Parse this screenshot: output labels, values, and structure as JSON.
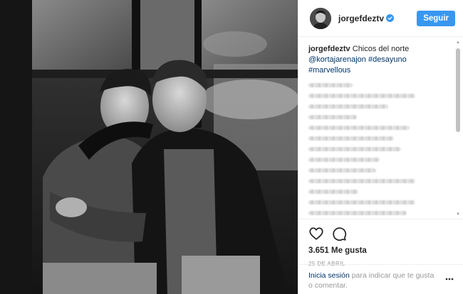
{
  "post": {
    "username": "jorgefdeztv",
    "follow_label": "Seguir",
    "caption_user": "jorgefdeztv",
    "caption_text": "Chicos del norte",
    "caption_tags": [
      "@kortajarenajon",
      "#desayuno",
      "#marvellous"
    ],
    "likes_count": "3.651",
    "likes_label": "Me gusta",
    "date": "25 DE ABRIL"
  },
  "login": {
    "link_label": "Inicia sesión",
    "rest_label": "para indicar que te gusta o comentar."
  },
  "icons": {
    "verified": "verified-badge-icon",
    "like": "heart-icon",
    "comment": "comment-bubble-icon",
    "more": "more-options-icon"
  },
  "colors": {
    "accent": "#3897f0",
    "link": "#003569",
    "muted": "#999999"
  }
}
